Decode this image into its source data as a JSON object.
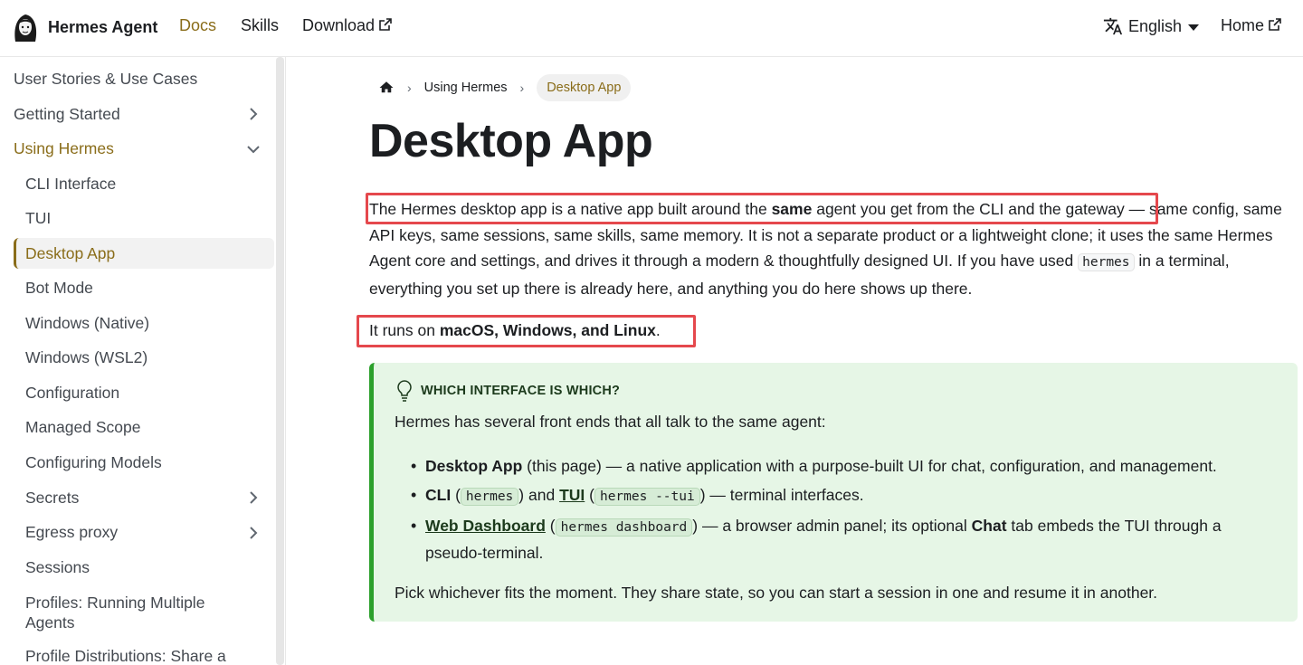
{
  "navbar": {
    "brand": "Hermes Agent",
    "links": {
      "docs": "Docs",
      "skills": "Skills",
      "download": "Download",
      "home": "Home"
    },
    "language": "English"
  },
  "sidebar": {
    "items": [
      "User Stories & Use Cases",
      "Getting Started",
      "Using Hermes",
      "CLI Interface",
      "TUI",
      "Desktop App",
      "Bot Mode",
      "Windows (Native)",
      "Windows (WSL2)",
      "Configuration",
      "Managed Scope",
      "Configuring Models",
      "Secrets",
      "Egress proxy",
      "Sessions",
      "Profiles: Running Multiple Agents",
      "Profile Distributions: Share a"
    ],
    "active_item": "Desktop App"
  },
  "breadcrumb": {
    "section": "Using Hermes",
    "current": "Desktop App"
  },
  "page": {
    "title": "Desktop App",
    "p1": {
      "a": "The Hermes desktop app is a native app built around the ",
      "b": "same",
      "c": " agent you get from the CLI and the gateway",
      "d": " — same config, same API keys, same sessions, same skills, same memory. It is not a separate product or a lightweight clone; it uses the same Hermes Agent core and settings, and drives it through a modern & thoughtfully designed UI. If you have used ",
      "code": "hermes",
      "e": " in a terminal, everything you set up there is already here, and anything you do here shows up there."
    },
    "p2": {
      "a": "It runs on ",
      "b": "macOS, Windows, and Linux",
      "c": "."
    }
  },
  "admonition": {
    "title": "WHICH INTERFACE IS WHICH?",
    "intro": "Hermes has several front ends that all talk to the same agent:",
    "li1": {
      "name": "Desktop App",
      "text": " (this page) — a native application with a purpose-built UI for chat, configuration, and management."
    },
    "li2": {
      "name": "CLI",
      "code1": "hermes",
      "and": " and ",
      "link": "TUI",
      "code2": "hermes --tui",
      "text": " — terminal interfaces."
    },
    "li3": {
      "link": "Web Dashboard",
      "code": "hermes dashboard",
      "text1": " — a browser admin panel; its optional ",
      "bold": "Chat",
      "text2": " tab embeds the TUI through a pseudo-terminal."
    },
    "outro": "Pick whichever fits the moment. They share state, so you can start a session in one and resume it in another."
  }
}
